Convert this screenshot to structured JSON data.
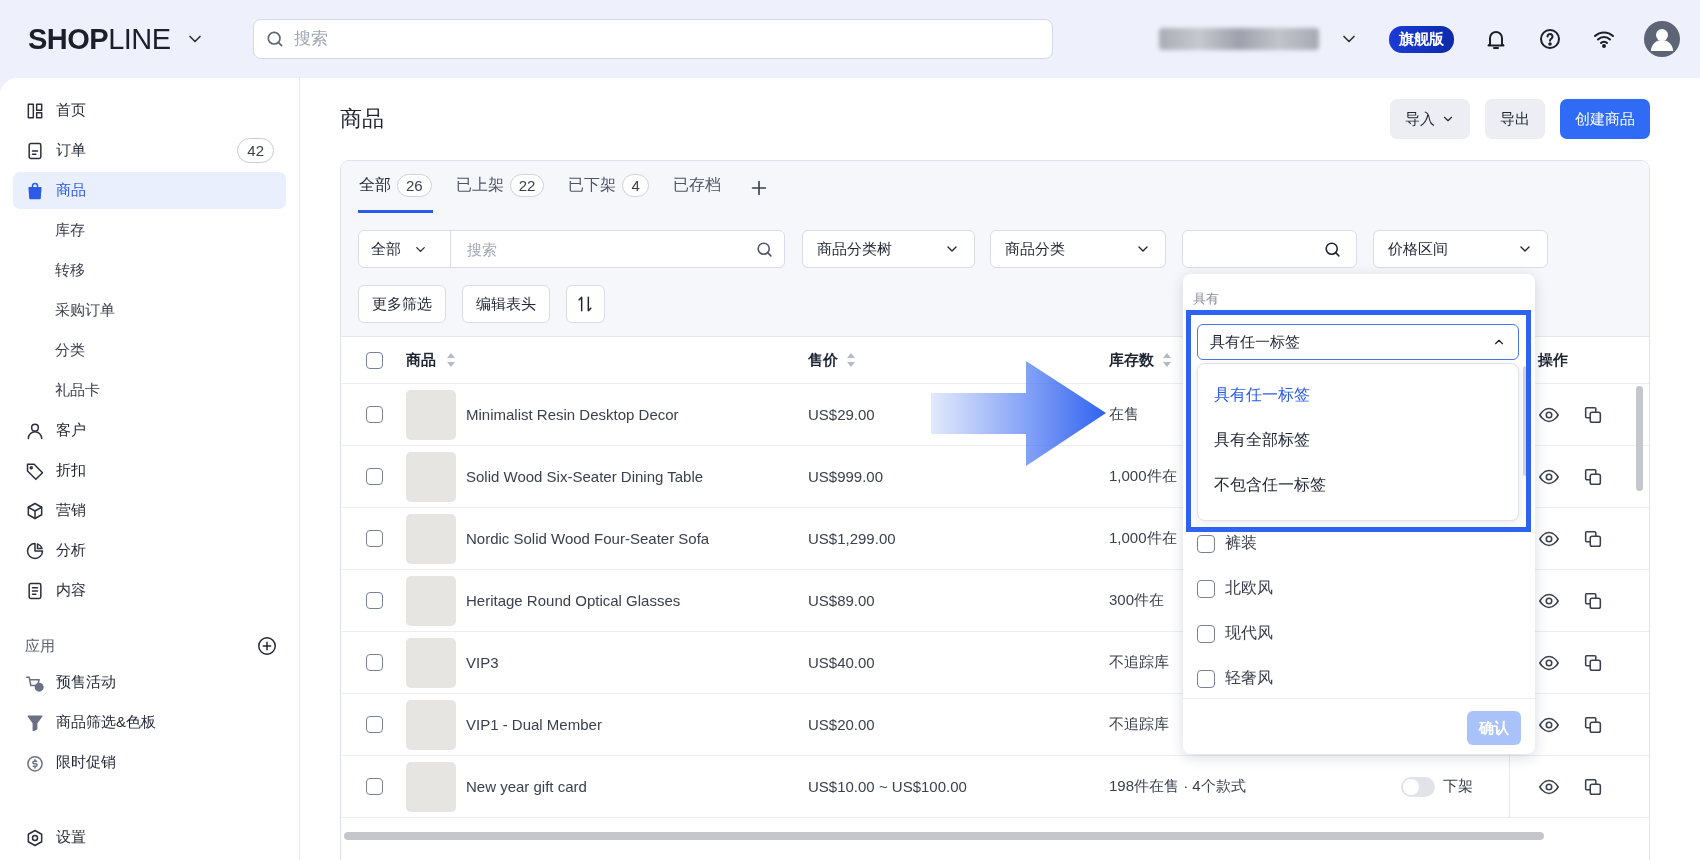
{
  "topbar": {
    "logo": "**SHOP**LINE",
    "search": {
      "placeholder": "搜索"
    },
    "plan_badge": "旗舰版"
  },
  "sidebar": {
    "items": [
      {
        "label": "首页",
        "selected": false
      },
      {
        "label": "订单",
        "badge": "42",
        "selected": false
      },
      {
        "label": "商品",
        "selected": true,
        "children": [
          {
            "label": "库存",
            "selected": false
          },
          {
            "label": "转移",
            "selected": false
          },
          {
            "label": "采购订单",
            "selected": false
          },
          {
            "label": "分类",
            "selected": false
          },
          {
            "label": "礼品卡",
            "selected": false
          }
        ]
      },
      {
        "label": "客户",
        "selected": false
      },
      {
        "label": "折扣",
        "selected": false
      },
      {
        "label": "营销",
        "selected": false
      },
      {
        "label": "分析",
        "selected": false
      },
      {
        "label": "内容",
        "selected": false
      }
    ],
    "apps": {
      "title": "应用",
      "items": [
        {
          "label": "预售活动",
          "selected": false
        },
        {
          "label": "商品筛选&色板",
          "selected": false
        },
        {
          "label": "限时促销",
          "selected": false
        }
      ]
    },
    "settings": {
      "label": "设置",
      "selected": false
    }
  },
  "page": {
    "title": "商品",
    "actions": [
      {
        "label": "导入",
        "kind": "menu"
      },
      {
        "label": "导出",
        "kind": "plain"
      },
      {
        "label": "创建商品",
        "kind": "primary"
      }
    ]
  },
  "tabs": [
    {
      "label": "全部",
      "count": "26",
      "selected": true
    },
    {
      "label": "已上架",
      "count": "22",
      "selected": false
    },
    {
      "label": "已下架",
      "count": "4",
      "selected": false
    },
    {
      "label": "已存档",
      "selected": false
    }
  ],
  "filters": {
    "scope": "全部",
    "search": {
      "placeholder": "搜索"
    },
    "selects": [
      {
        "label": "商品分类树"
      },
      {
        "label": "商品分类"
      }
    ],
    "price_range": "价格区间",
    "buttons": [
      {
        "label": "更多筛选"
      },
      {
        "label": "编辑表头"
      }
    ]
  },
  "tag_filter": {
    "expanded": true,
    "mode_label": "具有",
    "mode": {
      "value": "具有任一标签",
      "expanded": true
    },
    "mode_options": [
      {
        "label": "具有任一标签",
        "selected": true
      },
      {
        "label": "具有全部标签",
        "selected": false
      },
      {
        "label": "不包含任一标签",
        "selected": false
      }
    ],
    "tags": [
      {
        "label": "裤装",
        "checked": false
      },
      {
        "label": "北欧风",
        "checked": false
      },
      {
        "label": "现代风",
        "checked": false
      },
      {
        "label": "轻奢风",
        "checked": false
      }
    ],
    "confirm": {
      "label": "确认",
      "disabled": true
    }
  },
  "table": {
    "select_all": {
      "checked": false
    },
    "columns": [
      {
        "label": "商品",
        "sortable": true
      },
      {
        "label": "售价",
        "sortable": true
      },
      {
        "label": "库存数",
        "sortable": true
      },
      {
        "label": "操作",
        "sortable": false
      }
    ],
    "rows": [
      {
        "checked": false,
        "name": "Minimalist Resin Desktop Decor",
        "price": "US$29.00",
        "stock": "在售"
      },
      {
        "checked": false,
        "name": "Solid Wood Six-Seater Dining Table",
        "price": "US$999.00",
        "stock": "1,000件在"
      },
      {
        "checked": false,
        "name": "Nordic Solid Wood Four-Seater Sofa",
        "price": "US$1,299.00",
        "stock": "1,000件在"
      },
      {
        "checked": false,
        "name": "Heritage Round Optical Glasses",
        "price": "US$89.00",
        "stock": "300件在"
      },
      {
        "checked": false,
        "name": "VIP3",
        "price": "US$40.00",
        "stock": "不追踪库"
      },
      {
        "checked": false,
        "name": "VIP1 - Dual Member",
        "price": "US$20.00",
        "stock": "不追踪库"
      },
      {
        "checked": false,
        "name": "New year gift card",
        "price": "US$10.00 ~ US$100.00",
        "stock": "198件在售 · 4个款式",
        "status": {
          "on": false,
          "label": "下架"
        }
      }
    ]
  }
}
